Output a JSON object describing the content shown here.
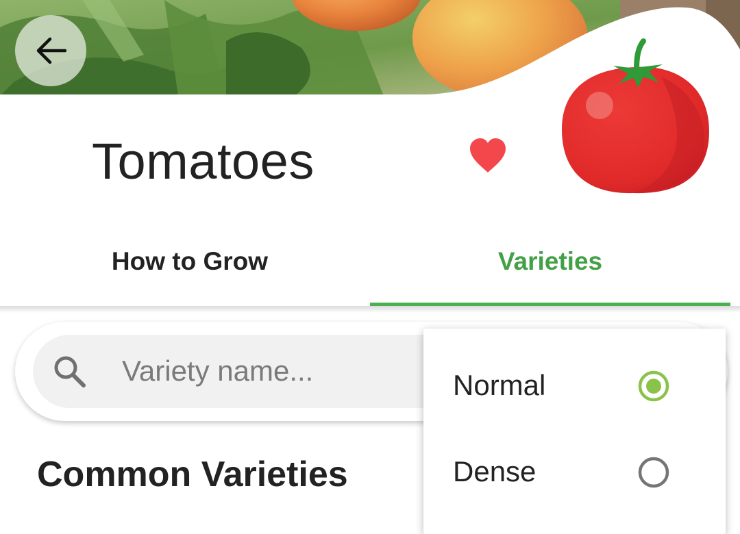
{
  "header": {
    "title": "Tomatoes",
    "back_icon": "arrow-left-icon",
    "favorite_icon": "heart-icon",
    "favorite_color": "#f4474b"
  },
  "tabs": [
    {
      "label": "How to Grow",
      "selected": false
    },
    {
      "label": "Varieties",
      "selected": true
    }
  ],
  "accent_color": "#4caf50",
  "search": {
    "placeholder": "Variety name...",
    "icon": "search-icon"
  },
  "section": {
    "heading": "Common Varieties"
  },
  "density_menu": {
    "options": [
      {
        "label": "Normal",
        "selected": true
      },
      {
        "label": "Dense",
        "selected": false
      }
    ],
    "radio_selected_color": "#8bc34a",
    "radio_unselected_color": "#757575"
  }
}
